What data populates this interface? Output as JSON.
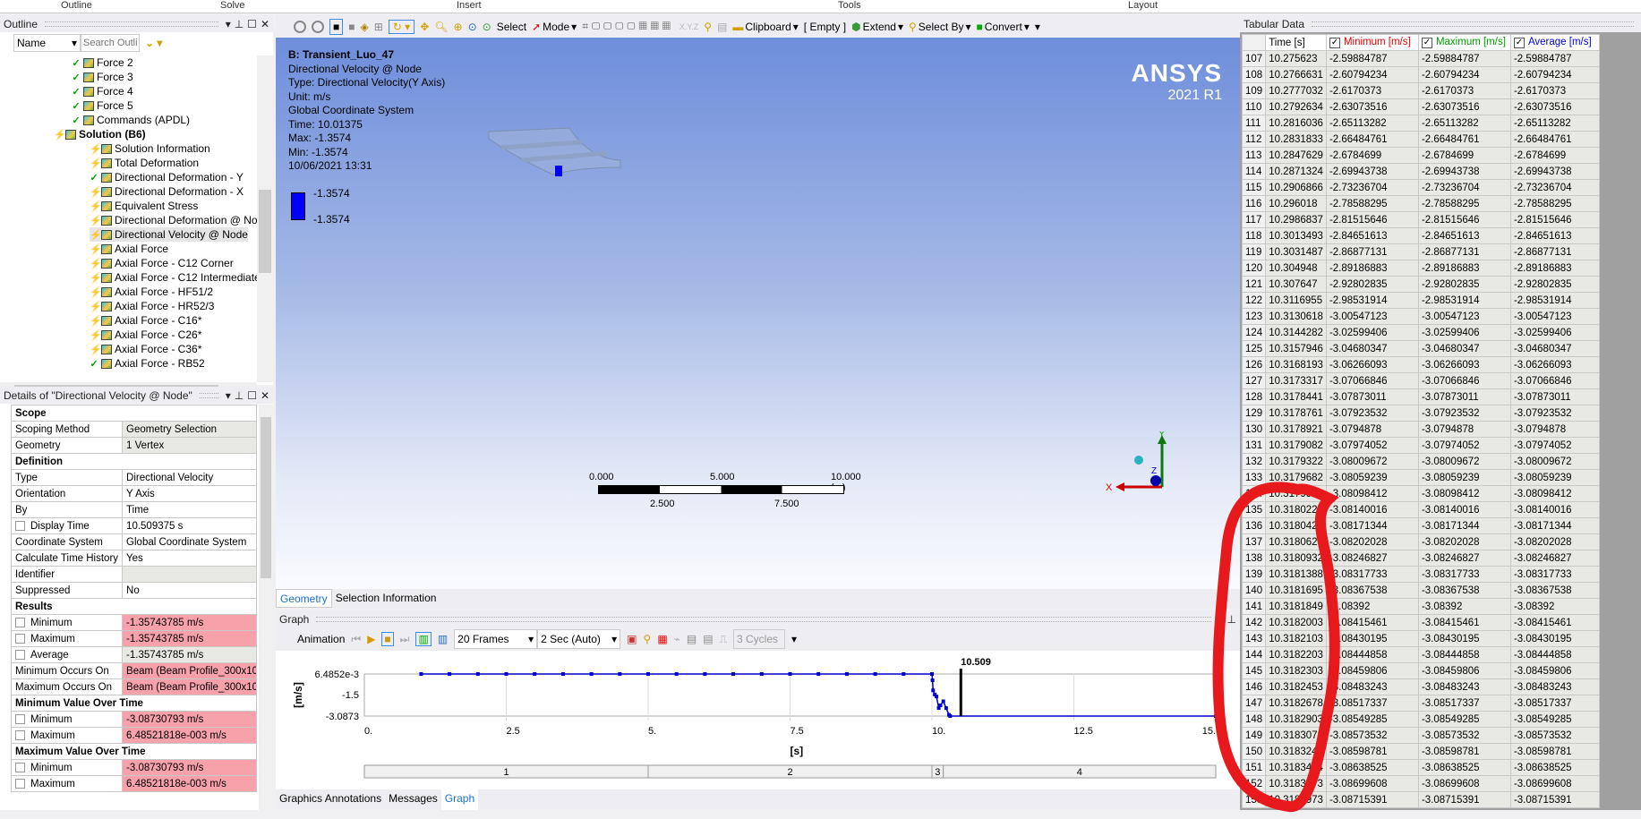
{
  "ribbon": {
    "groups": [
      "Outline",
      "Solve",
      "Insert",
      "Tools",
      "Layout"
    ]
  },
  "outline": {
    "title": "Outline",
    "name_filter": "Name",
    "search_placeholder": "Search Outline",
    "items": [
      {
        "label": "Force 2",
        "status": "ok",
        "level": 3,
        "bold": false
      },
      {
        "label": "Force 3",
        "status": "ok",
        "level": 3,
        "bold": false
      },
      {
        "label": "Force 4",
        "status": "ok",
        "level": 3,
        "bold": false
      },
      {
        "label": "Force 5",
        "status": "ok",
        "level": 3,
        "bold": false
      },
      {
        "label": "Commands (APDL)",
        "status": "ok",
        "level": 3,
        "bold": false
      },
      {
        "label": "Solution (B6)",
        "status": "bad",
        "level": 2,
        "bold": true
      },
      {
        "label": "Solution Information",
        "status": "bad",
        "level": 4,
        "bold": false
      },
      {
        "label": "Total Deformation",
        "status": "bad",
        "level": 4,
        "bold": false
      },
      {
        "label": "Directional Deformation - Y",
        "status": "ok",
        "level": 4,
        "bold": false
      },
      {
        "label": "Directional Deformation - X",
        "status": "bad",
        "level": 4,
        "bold": false
      },
      {
        "label": "Equivalent Stress",
        "status": "bad",
        "level": 4,
        "bold": false
      },
      {
        "label": "Directional Deformation @ Node",
        "status": "bad",
        "level": 4,
        "bold": false
      },
      {
        "label": "Directional Velocity @ Node",
        "status": "warn",
        "level": 4,
        "bold": false,
        "selected": true
      },
      {
        "label": "Axial Force",
        "status": "bad",
        "level": 4,
        "bold": false
      },
      {
        "label": "Axial Force - C12 Corner",
        "status": "warn",
        "level": 4,
        "bold": false
      },
      {
        "label": "Axial Force - C12 Intermediate",
        "status": "bad",
        "level": 4,
        "bold": false
      },
      {
        "label": "Axial Force  - HF51/2",
        "status": "bad",
        "level": 4,
        "bold": false
      },
      {
        "label": "Axial Force - HR52/3",
        "status": "bad",
        "level": 4,
        "bold": false
      },
      {
        "label": "Axial Force  - C16*",
        "status": "bad",
        "level": 4,
        "bold": false
      },
      {
        "label": "Axial Force  - C26*",
        "status": "bad",
        "level": 4,
        "bold": false
      },
      {
        "label": "Axial Force  - C36*",
        "status": "bad",
        "level": 4,
        "bold": false
      },
      {
        "label": "Axial Force  - RB52",
        "status": "ok",
        "level": 4,
        "bold": false
      }
    ]
  },
  "details": {
    "title": "Details of \"Directional Velocity @ Node\"",
    "rows": [
      {
        "type": "section",
        "label": "Scope"
      },
      {
        "label": "Scoping Method",
        "value": "Geometry Selection",
        "style": "g"
      },
      {
        "label": "Geometry",
        "value": "1 Vertex",
        "style": "g"
      },
      {
        "type": "section",
        "label": "Definition"
      },
      {
        "label": "Type",
        "value": "Directional Velocity"
      },
      {
        "label": "Orientation",
        "value": "Y Axis"
      },
      {
        "label": "By",
        "value": "Time"
      },
      {
        "label": "Display Time",
        "value": "10.509375 s",
        "checkbox": true
      },
      {
        "label": "Coordinate System",
        "value": "Global Coordinate System"
      },
      {
        "label": "Calculate Time History",
        "value": "Yes"
      },
      {
        "label": "Identifier",
        "value": "",
        "style": "g"
      },
      {
        "label": "Suppressed",
        "value": "No"
      },
      {
        "type": "section",
        "label": "Results"
      },
      {
        "label": "Minimum",
        "value": "-1.35743785 m/s",
        "checkbox": true,
        "style": "r"
      },
      {
        "label": "Maximum",
        "value": "-1.35743785 m/s",
        "checkbox": true,
        "style": "r"
      },
      {
        "label": "Average",
        "value": "-1.35743785 m/s",
        "checkbox": true,
        "style": "g"
      },
      {
        "label": "Minimum Occurs On",
        "value": "Beam (Beam Profile_300x10...",
        "style": "r"
      },
      {
        "label": "Maximum Occurs On",
        "value": "Beam (Beam Profile_300x10...",
        "style": "r"
      },
      {
        "type": "section",
        "label": "Minimum Value Over Time"
      },
      {
        "label": "Minimum",
        "value": "-3.08730793 m/s",
        "checkbox": true,
        "style": "r"
      },
      {
        "label": "Maximum",
        "value": "6.48521818e-003 m/s",
        "checkbox": true,
        "style": "r"
      },
      {
        "type": "section",
        "label": "Maximum Value Over Time"
      },
      {
        "label": "Minimum",
        "value": "-3.08730793 m/s",
        "checkbox": true,
        "style": "r"
      },
      {
        "label": "Maximum",
        "value": "6.48521818e-003 m/s",
        "checkbox": true,
        "style": "r"
      }
    ]
  },
  "toolbar": {
    "select": "Select",
    "mode": "Mode",
    "clipboard": "Clipboard",
    "empty": "[ Empty ]",
    "extend": "Extend",
    "select_by": "Select By",
    "convert": "Convert"
  },
  "viewport": {
    "title": "B: Transient_Luo_47",
    "lines": [
      "Directional Velocity @ Node",
      "Type: Directional Velocity(Y Axis)",
      "Unit: m/s",
      "Global Coordinate System",
      "Time: 10.01375",
      "Max: -1.3574",
      "Min: -1.3574",
      "10/06/2021 13:31"
    ],
    "legend": {
      "max": "-1.3574",
      "min": "-1.3574",
      "color": "#0000ff"
    },
    "logo": "ANSYS",
    "version": "2021 R1",
    "scale": {
      "top": [
        "0.000",
        "5.000",
        "10.000 (m)"
      ],
      "bottom": [
        "2.500",
        "7.500"
      ]
    },
    "triad": {
      "x": "X",
      "y": "Y",
      "z": "Z"
    }
  },
  "geom_tabs": [
    "Geometry",
    "Selection Information"
  ],
  "graph": {
    "title": "Graph",
    "animation": "Animation",
    "frames": "20 Frames",
    "duration": "2 Sec (Auto)",
    "cycles": "3 Cycles"
  },
  "chart_data": {
    "type": "line",
    "xlabel": "[s]",
    "ylabel": "[m/s]",
    "xlim": [
      0,
      15
    ],
    "ylim": [
      -3.0873,
      0.0064852
    ],
    "x_ticks": [
      "0.",
      "2.5",
      "5.",
      "7.5",
      "10.",
      "12.5",
      "15."
    ],
    "y_ticks": [
      "6.4852e-3",
      "-1.5",
      "-3.0873"
    ],
    "marker_time": "10.509",
    "steps": [
      {
        "label": "1",
        "range": [
          0,
          5
        ]
      },
      {
        "label": "2",
        "range": [
          5,
          10
        ]
      },
      {
        "label": "3",
        "range": [
          10,
          10.2
        ]
      },
      {
        "label": "4",
        "range": [
          10.2,
          15
        ]
      }
    ],
    "series": [
      {
        "color": "#0000cc",
        "x": [
          1,
          1.5,
          2,
          2.5,
          3,
          3.5,
          4,
          4.5,
          5,
          5.5,
          6,
          6.5,
          7,
          7.5,
          8,
          8.5,
          9,
          9.5,
          10,
          10.01,
          10.02,
          10.05,
          10.08,
          10.12,
          10.15,
          10.2,
          10.25,
          10.3,
          10.32,
          15
        ],
        "y": [
          0.0064852,
          0.0064852,
          0.0064852,
          0.0064852,
          0.0064852,
          0.0064852,
          0.0064852,
          0.0064852,
          0.0064852,
          0.0064852,
          0.0064852,
          0.0064852,
          0.0064852,
          0.0064852,
          0.0064852,
          0.0064852,
          0.0064852,
          0.0064852,
          0.0064852,
          -0.45,
          -1.2,
          -1.5,
          -1.65,
          -2.5,
          -2.3,
          -2.0,
          -2.5,
          -3.0,
          -3.0873,
          -3.0873
        ]
      }
    ]
  },
  "bottom_tabs": [
    "Graphics Annotations",
    "Messages",
    "Graph"
  ],
  "tabular": {
    "title": "Tabular Data",
    "headers": [
      "Time [s]",
      "Minimum [m/s]",
      "Maximum [m/s]",
      "Average [m/s]"
    ],
    "header_colors": [
      "#000000",
      "#e00000",
      "#00a000",
      "#0000e0"
    ],
    "rows": [
      [
        "107",
        "10.275623",
        "-2.59884787"
      ],
      [
        "108",
        "10.2766631",
        "-2.60794234"
      ],
      [
        "109",
        "10.2777032",
        "-2.6170373"
      ],
      [
        "110",
        "10.2792634",
        "-2.63073516"
      ],
      [
        "111",
        "10.2816036",
        "-2.65113282"
      ],
      [
        "112",
        "10.2831833",
        "-2.66484761"
      ],
      [
        "113",
        "10.2847629",
        "-2.6784699"
      ],
      [
        "114",
        "10.2871324",
        "-2.69943738"
      ],
      [
        "115",
        "10.2906866",
        "-2.73236704"
      ],
      [
        "116",
        "10.296018",
        "-2.78588295"
      ],
      [
        "117",
        "10.2986837",
        "-2.81515646"
      ],
      [
        "118",
        "10.3013493",
        "-2.84651613"
      ],
      [
        "119",
        "10.3031487",
        "-2.86877131"
      ],
      [
        "120",
        "10.304948",
        "-2.89186883"
      ],
      [
        "121",
        "10.307647",
        "-2.92802835"
      ],
      [
        "122",
        "10.3116955",
        "-2.98531914"
      ],
      [
        "123",
        "10.3130618",
        "-3.00547123"
      ],
      [
        "124",
        "10.3144282",
        "-3.02599406"
      ],
      [
        "125",
        "10.3157946",
        "-3.04680347"
      ],
      [
        "126",
        "10.3168193",
        "-3.06266093"
      ],
      [
        "127",
        "10.3173317",
        "-3.07066846"
      ],
      [
        "128",
        "10.3178441",
        "-3.07873011"
      ],
      [
        "129",
        "10.3178761",
        "-3.07923532"
      ],
      [
        "130",
        "10.3178921",
        "-3.0794878"
      ],
      [
        "131",
        "10.3179082",
        "-3.07974052"
      ],
      [
        "132",
        "10.3179322",
        "-3.08009672"
      ],
      [
        "133",
        "10.3179682",
        "-3.08059239"
      ],
      [
        "134",
        "10.3179952",
        "-3.08098412"
      ],
      [
        "135",
        "10.3180222",
        "-3.08140016"
      ],
      [
        "136",
        "10.3180425",
        "-3.08171344"
      ],
      [
        "137",
        "10.3180628",
        "-3.08202028"
      ],
      [
        "138",
        "10.3180932",
        "-3.08246827"
      ],
      [
        "139",
        "10.3181388",
        "-3.08317733"
      ],
      [
        "140",
        "10.3181695",
        "-3.08367538"
      ],
      [
        "141",
        "10.3181849",
        "-3.08392"
      ],
      [
        "142",
        "10.3182003",
        "-3.08415461"
      ],
      [
        "143",
        "10.3182103",
        "-3.08430195"
      ],
      [
        "144",
        "10.3182203",
        "-3.08444858"
      ],
      [
        "145",
        "10.3182303",
        "-3.08459806"
      ],
      [
        "146",
        "10.3182453",
        "-3.08483243"
      ],
      [
        "147",
        "10.3182678",
        "-3.08517337"
      ],
      [
        "148",
        "10.3182903",
        "-3.08549285"
      ],
      [
        "149",
        "10.3183072",
        "-3.08573532"
      ],
      [
        "150",
        "10.3183241",
        "-3.08598781"
      ],
      [
        "151",
        "10.3183494",
        "-3.08638525"
      ],
      [
        "152",
        "10.3183873",
        "-3.08699608"
      ],
      [
        "153",
        "10.3183973",
        "-3.08715391"
      ]
    ]
  },
  "annotation": {
    "color": "#e8191c"
  }
}
